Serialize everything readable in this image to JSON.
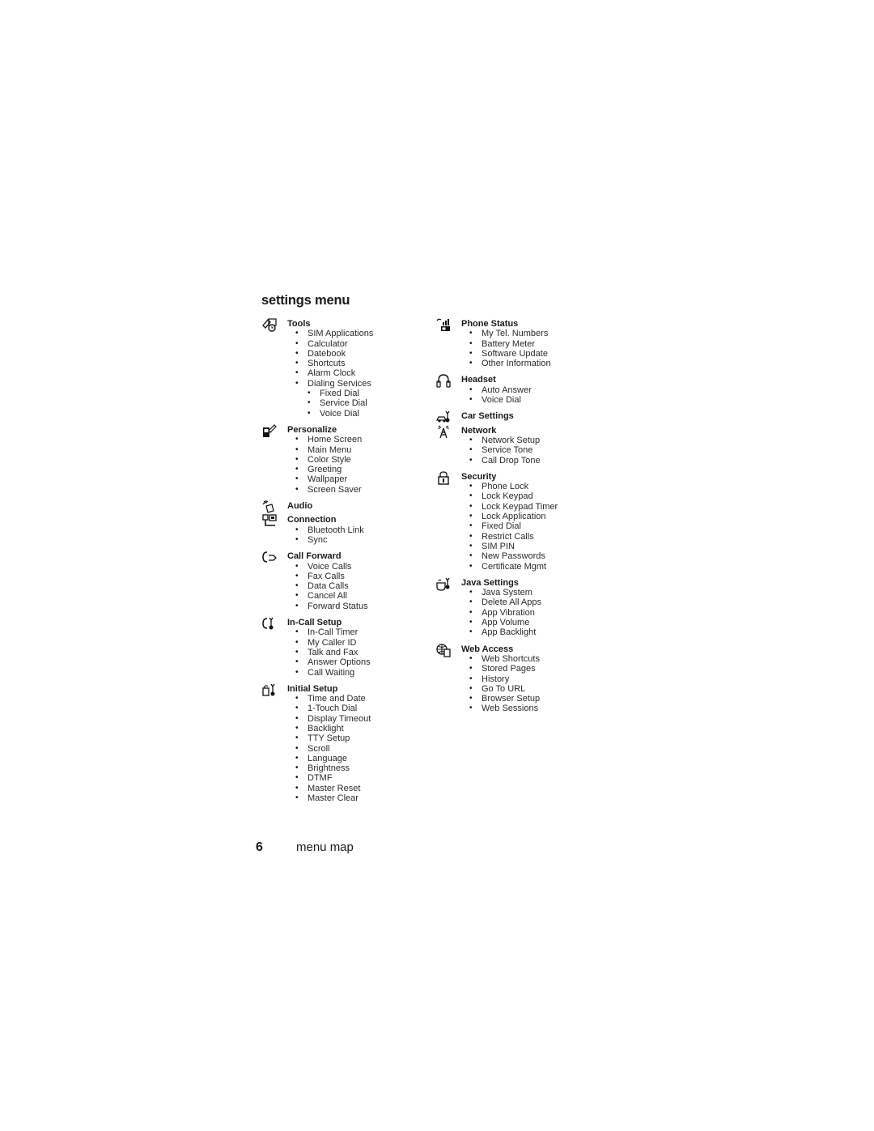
{
  "page_title": "settings menu",
  "footer": {
    "page_number": "6",
    "section": "menu map"
  },
  "left_column": [
    {
      "heading": "Tools",
      "icon": "tools-icon",
      "items": [
        {
          "label": "SIM Applications"
        },
        {
          "label": "Calculator"
        },
        {
          "label": "Datebook"
        },
        {
          "label": "Shortcuts"
        },
        {
          "label": "Alarm Clock"
        },
        {
          "label": "Dialing Services",
          "sub": [
            "Fixed Dial",
            "Service Dial",
            "Voice Dial"
          ]
        }
      ]
    },
    {
      "heading": "Personalize",
      "icon": "personalize-icon",
      "items": [
        "Home Screen",
        "Main Menu",
        "Color Style",
        "Greeting",
        "Wallpaper",
        "Screen Saver"
      ]
    },
    {
      "heading": "Audio",
      "icon": "audio-icon",
      "items": []
    },
    {
      "heading": "Connection",
      "icon": "connection-icon",
      "items": [
        "Bluetooth Link",
        "Sync"
      ]
    },
    {
      "heading": "Call Forward",
      "icon": "call-forward-icon",
      "items": [
        "Voice Calls",
        "Fax Calls",
        "Data Calls",
        "Cancel All",
        "Forward Status"
      ]
    },
    {
      "heading": "In-Call Setup",
      "icon": "in-call-setup-icon",
      "items": [
        "In-Call Timer",
        "My Caller ID",
        "Talk and Fax",
        "Answer Options",
        "Call Waiting"
      ]
    },
    {
      "heading": "Initial Setup",
      "icon": "initial-setup-icon",
      "items": [
        "Time and Date",
        "1-Touch Dial",
        "Display Timeout",
        "Backlight",
        "TTY Setup",
        "Scroll",
        "Language",
        "Brightness",
        "DTMF",
        "Master Reset",
        "Master Clear"
      ]
    }
  ],
  "right_column": [
    {
      "heading": "Phone Status",
      "icon": "phone-status-icon",
      "items": [
        "My Tel. Numbers",
        "Battery Meter",
        "Software Update",
        "Other Information"
      ]
    },
    {
      "heading": "Headset",
      "icon": "headset-icon",
      "items": [
        "Auto Answer",
        "Voice Dial"
      ]
    },
    {
      "heading": "Car Settings",
      "icon": "car-settings-icon",
      "items": []
    },
    {
      "heading": "Network",
      "icon": "network-icon",
      "items": [
        "Network Setup",
        "Service Tone",
        "Call Drop Tone"
      ]
    },
    {
      "heading": "Security",
      "icon": "security-icon",
      "items": [
        "Phone Lock",
        "Lock Keypad",
        "Lock Keypad Timer",
        "Lock Application",
        "Fixed Dial",
        "Restrict Calls",
        "SIM PIN",
        "New Passwords",
        "Certificate Mgmt"
      ]
    },
    {
      "heading": "Java Settings",
      "icon": "java-settings-icon",
      "items": [
        "Java System",
        "Delete All Apps",
        "App Vibration",
        "App Volume",
        "App Backlight"
      ]
    },
    {
      "heading": "Web Access",
      "icon": "web-access-icon",
      "items": [
        "Web Shortcuts",
        "Stored Pages",
        "History",
        "Go To URL",
        "Browser Setup",
        "Web Sessions"
      ]
    }
  ]
}
